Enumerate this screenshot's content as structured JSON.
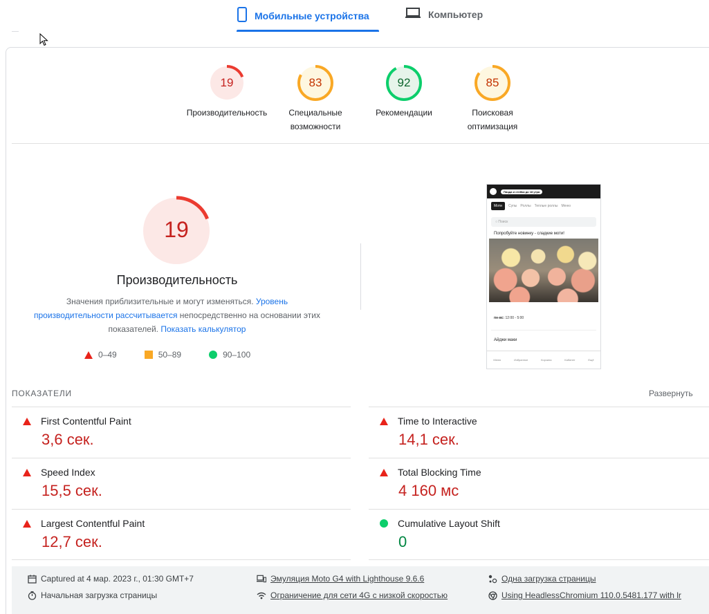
{
  "tabs": {
    "mobile_label": "Мобильные устройства",
    "desktop_label": "Компьютер"
  },
  "gauges": [
    {
      "score": "19",
      "label": "Производительность",
      "color": "#c5221f",
      "bg": "#fce8e6",
      "stroke": "#eb3b30",
      "fraction": 0.19
    },
    {
      "score": "83",
      "label": "Специальные возможности",
      "color": "#c33300",
      "bg": "#fef7e0",
      "stroke": "#f9a825",
      "fraction": 0.83
    },
    {
      "score": "92",
      "label": "Рекомендации",
      "color": "#0d652d",
      "bg": "#e6f4ea",
      "stroke": "#0cce6b",
      "fraction": 0.92
    },
    {
      "score": "85",
      "label": "Поисковая оптимизация",
      "color": "#c33300",
      "bg": "#fef7e0",
      "stroke": "#f9a825",
      "fraction": 0.85
    }
  ],
  "performance": {
    "score": "19",
    "fraction": 0.19,
    "title": "Производительность",
    "desc_part1": "Значения приблизительные и могут изменяться. ",
    "desc_link1": "Уровень производительности рассчитывается",
    "desc_part2": " непосредственно на основании этих показателей. ",
    "desc_link2": "Показать калькулятор"
  },
  "legend": {
    "fail": "0–49",
    "average": "50–89",
    "pass": "90–100"
  },
  "phone": {
    "pill": "Пицца и стейки до 18 утра",
    "tabs": [
      "Моти",
      "Супы",
      "Роллы",
      "Теплые роллы",
      "Меню"
    ],
    "search": "Поиск",
    "promo": "Попробуйте новинку - сладкие моти!",
    "hours_label": "пн-вс:",
    "hours": "12:00 - 5:00",
    "aidzhi": "Айджи маки",
    "nav": [
      "Меню",
      "Избранное",
      "Корзина",
      "Кабинет",
      "Ещё"
    ]
  },
  "metrics": {
    "heading": "ПОКАЗАТЕЛИ",
    "expand": "Развернуть",
    "items": [
      {
        "name": "First Contentful Paint",
        "value": "3,6 сек."
      },
      {
        "name": "Time to Interactive",
        "value": "14,1 сек."
      },
      {
        "name": "Speed Index",
        "value": "15,5 сек."
      },
      {
        "name": "Total Blocking Time",
        "value": "4 160 мс"
      },
      {
        "name": "Largest Contentful Paint",
        "value": "12,7 сек."
      },
      {
        "name": "Cumulative Layout Shift",
        "value": "0"
      }
    ]
  },
  "footer": {
    "captured": "Captured at 4 мар. 2023 г., 01:30 GMT+7",
    "initial_load": "Начальная загрузка страницы",
    "emulation": "Эмуляция Moto G4 with Lighthouse 9.6.6",
    "throttling": "Ограничение для сети 4G с низкой скоростью",
    "single_load": "Одна загрузка страницы",
    "browser": "Using HeadlessChromium 110.0.5481.177 with lr"
  }
}
